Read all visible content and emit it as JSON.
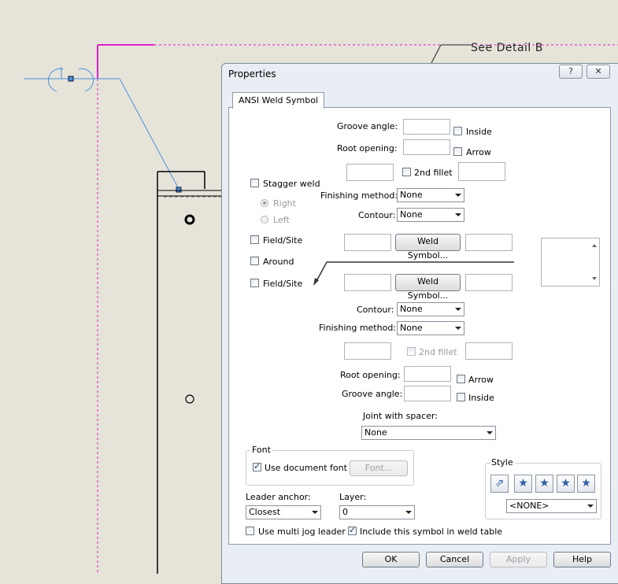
{
  "canvas": {
    "detail_note": "See Detail B"
  },
  "dialog": {
    "title": "Properties",
    "help_button": "?",
    "close_button": "✕",
    "tab_label": "ANSI Weld Symbol",
    "top": {
      "groove_angle_label": "Groove angle:",
      "groove_angle_value": "",
      "inside_label": "Inside",
      "root_opening_label": "Root opening:",
      "root_opening_value": "",
      "arrow_label": "Arrow",
      "fillet_left_value": "",
      "second_fillet_label": "2nd fillet",
      "fillet_right_value": "",
      "finishing_method_label": "Finishing method:",
      "finishing_method_value": "None",
      "contour_label": "Contour:",
      "contour_value": "None",
      "weld_symbol_button": "Weld Symbol..."
    },
    "stagger_weld_label": "Stagger weld",
    "right_label": "Right",
    "left_label": "Left",
    "field_site_label": "Field/Site",
    "around_label": "Around",
    "bottom": {
      "field_site_label": "Field/Site",
      "weld_symbol_button": "Weld Symbol...",
      "contour_label": "Contour:",
      "contour_value": "None",
      "finishing_method_label": "Finishing method:",
      "finishing_method_value": "None",
      "second_fillet_label": "2nd fillet",
      "root_opening_label": "Root opening:",
      "arrow_label": "Arrow",
      "groove_angle_label": "Groove angle:",
      "inside_label": "Inside"
    },
    "joint_with_spacer_label": "Joint with spacer:",
    "joint_with_spacer_value": "None",
    "font_group": {
      "title": "Font",
      "use_document_font_label": "Use document font",
      "use_document_font_checked": true,
      "font_button": "Font..."
    },
    "style_group": {
      "title": "Style",
      "style_value": "<NONE>",
      "icons": [
        "style-link-icon",
        "add-style-icon",
        "delete-style-icon",
        "save-style-icon",
        "load-style-icon"
      ]
    },
    "leader_anchor_label": "Leader anchor:",
    "leader_anchor_value": "Closest",
    "layer_label": "Layer:",
    "layer_value": "0",
    "use_multi_jog_leader_label": "Use multi jog leader",
    "include_in_weld_table_label": "Include this symbol in weld table",
    "include_in_weld_table_checked": true,
    "buttons": {
      "ok": "OK",
      "cancel": "Cancel",
      "apply": "Apply",
      "help": "Help"
    }
  }
}
